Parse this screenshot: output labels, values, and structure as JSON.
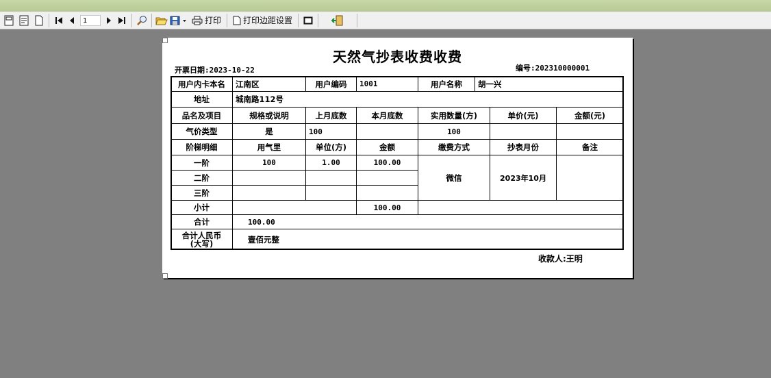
{
  "toolbar": {
    "page_value": "1",
    "print_label": "打印",
    "margin_label": "打印边距设置"
  },
  "report": {
    "title": "天然气抄表收费收费",
    "issue_date": "开票日期:2023-10-22",
    "serial": "编号:202310000001",
    "payee": "收款人:王明",
    "labels": {
      "card_name": "用户内卡本名",
      "user_code": "用户编码",
      "user_name": "用户名称",
      "address": "地址",
      "item": "品名及项目",
      "spec": "规格或说明",
      "last_reading": "上月底数",
      "this_reading": "本月底数",
      "actual_qty": "实用数量(方)",
      "unit_price": "单价(元)",
      "amount_yuan": "金额(元)",
      "gas_type": "气价类型",
      "tier_detail": "阶梯明细",
      "gas_usage": "用气里",
      "unit": "单位(方)",
      "amount": "金额",
      "pay_method": "缴费方式",
      "read_month": "抄表月份",
      "remark": "备注",
      "tier1": "一阶",
      "tier2": "二阶",
      "tier3": "三阶",
      "subtotal": "小计",
      "total": "合计",
      "total_rmb": "合计人民币\n(大写)"
    },
    "values": {
      "card_name": "江南区",
      "user_code": "1001",
      "user_name": "胡一兴",
      "address": "城南路112号",
      "spec": "是",
      "last_reading": "100",
      "actual_qty": "100",
      "tier1_usage": "100",
      "tier1_unit": "1.00",
      "tier1_amount": "100.00",
      "pay_method": "微信",
      "read_month": "2023年10月",
      "subtotal_amount": "100.00",
      "total": "100.00",
      "total_upper": "壹佰元整"
    }
  }
}
